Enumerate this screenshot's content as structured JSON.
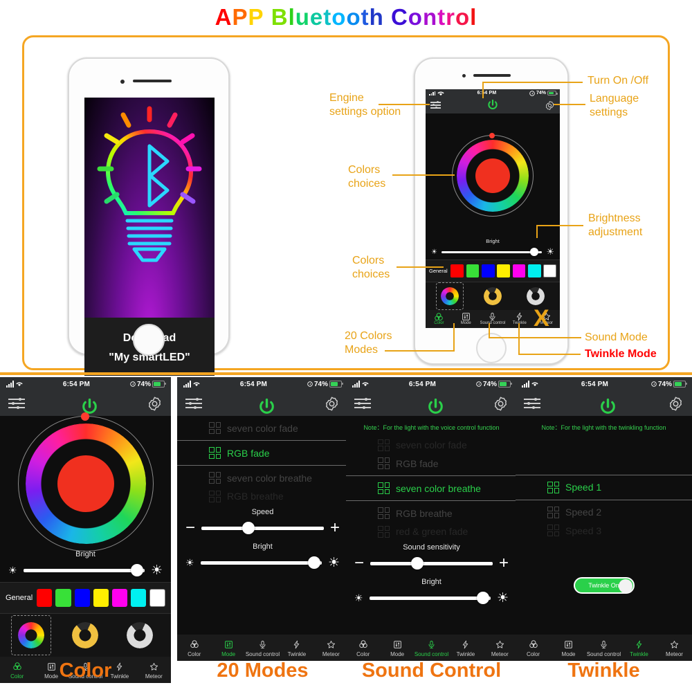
{
  "title": {
    "text": "APP Bluetooth Control",
    "letters": [
      {
        "c": "A",
        "color": "#ff0000"
      },
      {
        "c": "P",
        "color": "#ff6a00"
      },
      {
        "c": "P",
        "color": "#ffd400"
      },
      {
        "c": " ",
        "color": "#ffffff"
      },
      {
        "c": "B",
        "color": "#7ee000"
      },
      {
        "c": "l",
        "color": "#2fd11a"
      },
      {
        "c": "u",
        "color": "#12d36a"
      },
      {
        "c": "e",
        "color": "#0ec9a0"
      },
      {
        "c": "t",
        "color": "#0ec2c6"
      },
      {
        "c": "o",
        "color": "#00b6ff"
      },
      {
        "c": "o",
        "color": "#0a8cf0"
      },
      {
        "c": "t",
        "color": "#1f5ae0"
      },
      {
        "c": "h",
        "color": "#2038c8"
      },
      {
        "c": " ",
        "color": "#ffffff"
      },
      {
        "c": "C",
        "color": "#3b0fd6"
      },
      {
        "c": "o",
        "color": "#7a0fdc"
      },
      {
        "c": "n",
        "color": "#a90fd0"
      },
      {
        "c": "t",
        "color": "#d90fc0"
      },
      {
        "c": "r",
        "color": "#f0128c"
      },
      {
        "c": "o",
        "color": "#f5164a"
      },
      {
        "c": "l",
        "color": "#f21414"
      }
    ]
  },
  "left_phone": {
    "art_name": "bluetooth-bulb-artwork",
    "download_line1": "Download",
    "download_line2": "\"My smartLED\""
  },
  "status_bar": {
    "time": "6:54 PM",
    "battery_percent": "74%",
    "location_icon": "location-icon",
    "signal_icon": "signal-bars-icon",
    "wifi_icon": "wifi-icon"
  },
  "top_bar": {
    "engine_icon": "equalizer-settings-icon",
    "power_icon": "power-button-icon",
    "gear_icon": "gear-settings-icon"
  },
  "color_screen": {
    "bright_label": "Bright",
    "bright_value": 92,
    "general_label": "General",
    "swatches": [
      "#ff0000",
      "#38e038",
      "#0000ff",
      "#ffee00",
      "#ff00ee",
      "#00f0f0",
      "#ffffff"
    ],
    "presets": [
      "rainbow-ring-preset",
      "warm-white-ring-preset",
      "cool-white-ring-preset"
    ],
    "selected_preset": 0,
    "wheel_name": "color-wheel"
  },
  "tabs": [
    {
      "label": "Color",
      "icon": "color-circles-icon"
    },
    {
      "label": "Mode",
      "icon": "mode-sliders-icon"
    },
    {
      "label": "Sound control",
      "icon": "microphone-icon"
    },
    {
      "label": "Twinkle",
      "icon": "lightning-bolt-icon"
    },
    {
      "label": "Meteor",
      "icon": "star-icon"
    }
  ],
  "annotations": [
    {
      "id": "engine",
      "text": "Engine\nsettings option",
      "color": "#e8a317"
    },
    {
      "id": "turn-on-off",
      "text": "Turn On /Off",
      "color": "#e8a317"
    },
    {
      "id": "language",
      "text": "Language\nsettings",
      "color": "#e8a317"
    },
    {
      "id": "colors1",
      "text": "Colors\nchoices",
      "color": "#e8a317"
    },
    {
      "id": "brightness",
      "text": "Brightness\nadjustment",
      "color": "#e8a317"
    },
    {
      "id": "colors2",
      "text": "Colors\nchoices",
      "color": "#e8a317"
    },
    {
      "id": "modes20",
      "text": "20 Colors\nModes",
      "color": "#e8a317"
    },
    {
      "id": "soundmode",
      "text": "Sound Mode",
      "color": "#e8a317"
    },
    {
      "id": "twinklemode",
      "text": "Twinkle Mode",
      "color": "#ff0000"
    }
  ],
  "panels": [
    {
      "caption": "Color",
      "active_tab": 0,
      "content": "color",
      "bright_label": "Bright",
      "bright_value": 92,
      "general_label": "General"
    },
    {
      "caption": "20 Modes",
      "active_tab": 1,
      "content": "modes",
      "note": "",
      "modes": [
        {
          "label": "seven color fade",
          "state": "dim"
        },
        {
          "label": "RGB fade",
          "state": "selected"
        },
        {
          "label": "seven color breathe",
          "state": "dim"
        },
        {
          "label": "RGB breathe",
          "state": "dimmer"
        }
      ],
      "slider1_label": "Speed",
      "slider1_value": 37,
      "slider1_style": "plusminus",
      "bright_label": "Bright",
      "bright_value": 92
    },
    {
      "caption": "Sound Control",
      "active_tab": 2,
      "content": "modes",
      "note": "Note：For the light with the voice control function",
      "modes": [
        {
          "label": "seven color fade",
          "state": "dimmer"
        },
        {
          "label": "RGB fade",
          "state": "dim"
        },
        {
          "label": "seven color breathe",
          "state": "selected"
        },
        {
          "label": "RGB breathe",
          "state": "dim"
        },
        {
          "label": "red & green fade",
          "state": "dimmer"
        }
      ],
      "slider1_label": "Sound sensitivity",
      "slider1_value": 37,
      "slider1_style": "plusminus",
      "bright_label": "Bright",
      "bright_value": 92
    },
    {
      "caption": "Twinkle",
      "active_tab": 3,
      "content": "twinkle",
      "note": "Note：For the light with the twinkling function",
      "modes": [
        {
          "label": "Speed 1",
          "state": "selected"
        },
        {
          "label": "Speed 2",
          "state": "dim"
        },
        {
          "label": "Speed 3",
          "state": "dimmer"
        }
      ],
      "toggle_label": "Twinkle On",
      "toggle_on": true
    }
  ],
  "colors": {
    "accent_orange": "#f5a623",
    "caption_orange": "#ef7411",
    "green": "#2ad04a",
    "red_annotation": "#ff0000"
  }
}
